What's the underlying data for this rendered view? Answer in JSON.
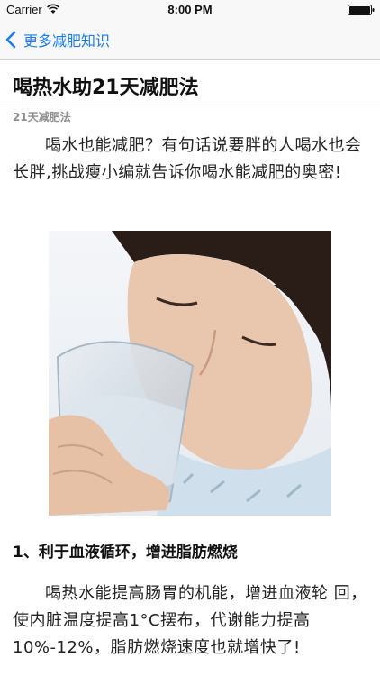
{
  "status_bar": {
    "carrier": "Carrier",
    "time": "8:00 PM"
  },
  "nav": {
    "back_label": "更多减肥知识",
    "accent_color": "#1a7cf5"
  },
  "article": {
    "title": "喝热水助21天减肥法",
    "source": "21天减肥法",
    "intro": "喝水也能减肥？有句话说要胖的人喝水也会长胖,挑战瘦小编就告诉你喝水能减肥的奥密!",
    "image_description_icon": "woman-drinking-water-photo",
    "section_heading": "1、利于血液循环，增进脂肪燃烧",
    "section_text": "喝热水能提高肠胃的机能，增进血液轮 回，使内脏温度提高1°C摆布，代谢能力提高10%-12%，脂肪燃烧速度也就增快了!"
  }
}
